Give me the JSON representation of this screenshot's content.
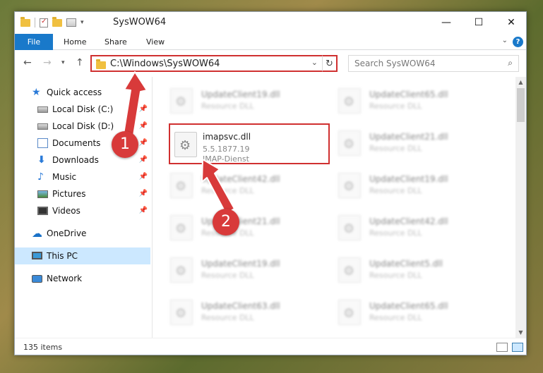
{
  "window": {
    "title": "SysWOW64",
    "controls": {
      "minimize": "—",
      "maximize": "☐",
      "close": "✕"
    }
  },
  "ribbon": {
    "tabs": [
      "File",
      "Home",
      "Share",
      "View"
    ],
    "help": "?"
  },
  "navigation": {
    "address": "C:\\Windows\\SysWOW64",
    "search_placeholder": "Search SysWOW64",
    "icons": [
      "back-arrow-icon",
      "forward-arrow-icon",
      "recent-dropdown-icon",
      "up-arrow-icon",
      "refresh-icon",
      "search-icon"
    ]
  },
  "sidebar": {
    "items": [
      {
        "label": "Quick access",
        "icon": "star-icon",
        "pinned": false
      },
      {
        "label": "Local Disk (C:)",
        "icon": "disk-icon",
        "pinned": true
      },
      {
        "label": "Local Disk (D:)",
        "icon": "disk-icon",
        "pinned": true
      },
      {
        "label": "Documents",
        "icon": "documents-icon",
        "pinned": true
      },
      {
        "label": "Downloads",
        "icon": "downloads-icon",
        "pinned": true
      },
      {
        "label": "Music",
        "icon": "music-icon",
        "pinned": true
      },
      {
        "label": "Pictures",
        "icon": "pictures-icon",
        "pinned": true
      },
      {
        "label": "Videos",
        "icon": "videos-icon",
        "pinned": true
      },
      {
        "label": "OneDrive",
        "icon": "onedrive-icon",
        "pinned": false
      },
      {
        "label": "This PC",
        "icon": "this-pc-icon",
        "pinned": false,
        "selected": true
      },
      {
        "label": "Network",
        "icon": "network-icon",
        "pinned": false
      }
    ]
  },
  "files": {
    "left": [
      {
        "name": "UpdateClient19.dll",
        "type": "Resource DLL"
      },
      {
        "name": "imapsvc.dll",
        "version": "5.5.1877.19",
        "type": "IMAP-Dienst",
        "highlighted": true
      },
      {
        "name": "UpdateClient42.dll",
        "type": "Resource DLL"
      },
      {
        "name": "UpdateClient21.dll",
        "type": "Resource DLL"
      },
      {
        "name": "UpdateClient19.dll",
        "type": "Resource DLL"
      },
      {
        "name": "UpdateClient63.dll",
        "type": "Resource DLL"
      }
    ],
    "right": [
      {
        "name": "UpdateClient65.dll",
        "type": "Resource DLL"
      },
      {
        "name": "UpdateClient21.dll",
        "type": "Resource DLL"
      },
      {
        "name": "UpdateClient19.dll",
        "type": "Resource DLL"
      },
      {
        "name": "UpdateClient42.dll",
        "type": "Resource DLL"
      },
      {
        "name": "UpdateClient5.dll",
        "type": "Resource DLL"
      },
      {
        "name": "UpdateClient65.dll",
        "type": "Resource DLL"
      }
    ]
  },
  "status": {
    "item_count": "135 items"
  },
  "annotations": {
    "step1": "1",
    "step2": "2",
    "color": "#d83a3a"
  }
}
